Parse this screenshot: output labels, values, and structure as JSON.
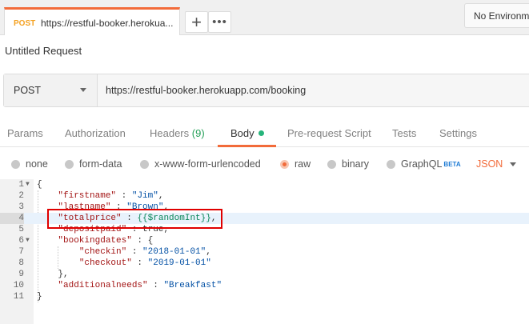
{
  "tab": {
    "method": "POST",
    "url": "https://restful-booker.herokua...",
    "accent_color": "#f26b3a"
  },
  "tab_controls": {
    "add_icon": "+",
    "more_icon": "•••"
  },
  "environment": {
    "label": "No Environment"
  },
  "request": {
    "name": "Untitled Request",
    "method": "POST",
    "url": "https://restful-booker.herokuapp.com/booking"
  },
  "subtabs": {
    "params": "Params",
    "authorization": "Authorization",
    "headers": "Headers",
    "headers_count": "(9)",
    "body": "Body",
    "prerequest": "Pre-request Script",
    "tests": "Tests",
    "settings": "Settings"
  },
  "body_types": {
    "none": "none",
    "form_data": "form-data",
    "urlencoded": "x-www-form-urlencoded",
    "raw": "raw",
    "binary": "binary",
    "graphql": "GraphQL",
    "graphql_badge": "BETA",
    "selected": "raw",
    "content_type": "JSON"
  },
  "editor": {
    "line_numbers": [
      "1",
      "2",
      "3",
      "4",
      "5",
      "6",
      "7",
      "8",
      "9",
      "10",
      "11"
    ],
    "highlighted_line": "4",
    "lines": {
      "l1": "{",
      "firstname_key": "\"firstname\"",
      "firstname_val": "\"Jim\"",
      "lastname_key": "\"lastname\"",
      "lastname_val": "\"Brown\"",
      "totalprice_key": "\"totalprice\"",
      "totalprice_val": "{{$randomInt}}",
      "depositpaid_key": "\"depositpaid\"",
      "depositpaid_val": "true",
      "bookingdates_key": "\"bookingdates\"",
      "checkin_key": "\"checkin\"",
      "checkin_val": "\"2018-01-01\"",
      "checkout_key": "\"checkout\"",
      "checkout_val": "\"2019-01-01\"",
      "close_inner": "},",
      "additionalneeds_key": "\"additionalneeds\"",
      "additionalneeds_val": "\"Breakfast\"",
      "l11": "}"
    }
  },
  "colors": {
    "json_key": "#a31515",
    "json_string": "#0451a5",
    "json_variable": "#098658",
    "annotation_box": "#e00000",
    "body_indicator": "#26b47b"
  }
}
